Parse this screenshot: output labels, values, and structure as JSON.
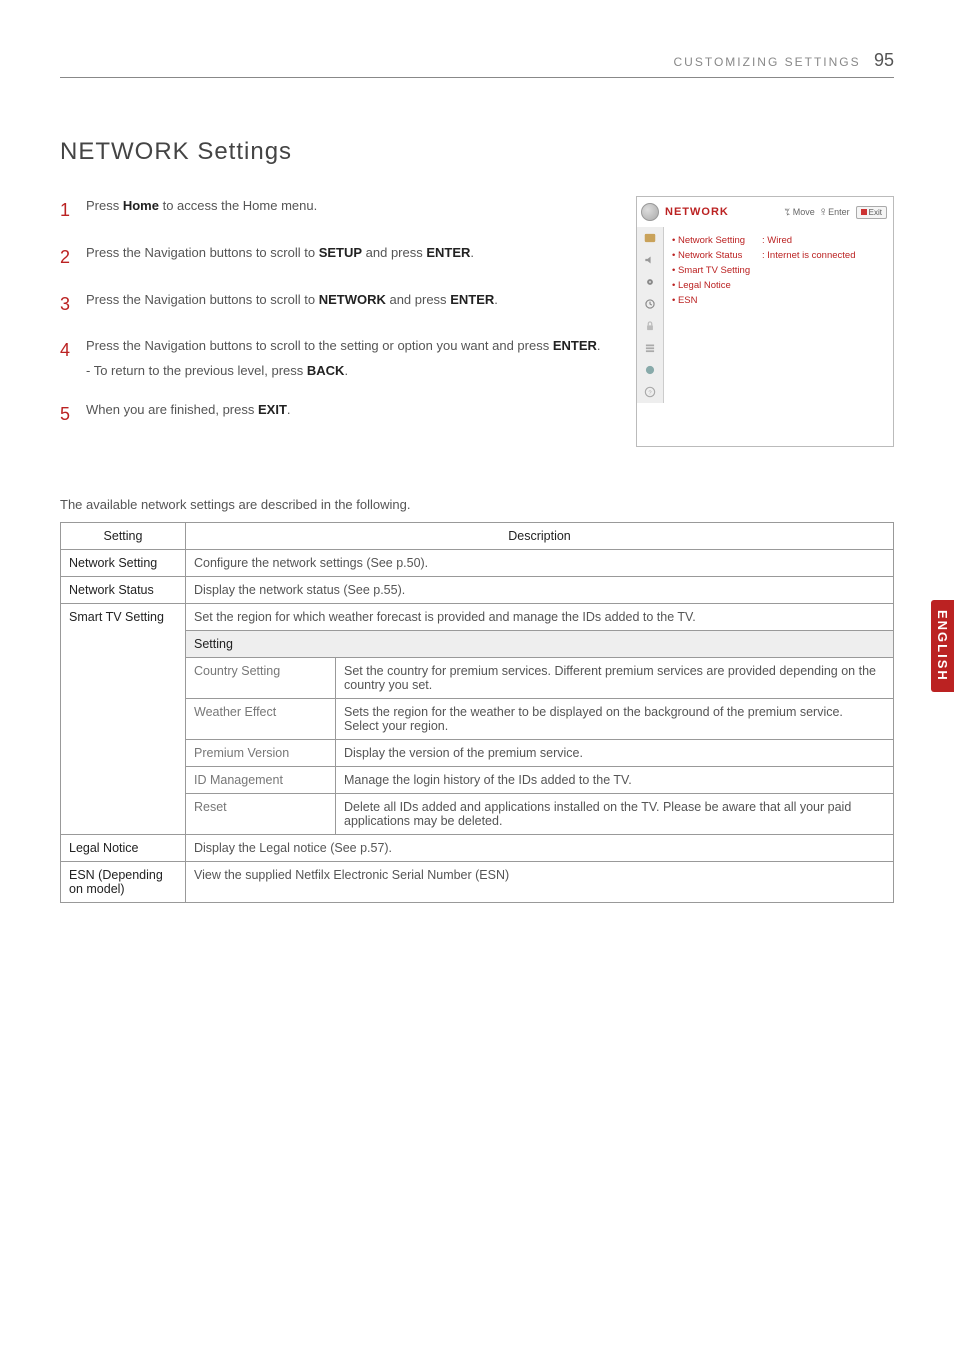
{
  "header": {
    "section_title": "CUSTOMIZING SETTINGS",
    "page_number": "95"
  },
  "title": "NETWORK Settings",
  "steps": [
    {
      "num": "1",
      "pre": "Press ",
      "b1": "Home",
      "post": " to access the Home menu."
    },
    {
      "num": "2",
      "pre": "Press the Navigation buttons to scroll to ",
      "b1": "SETUP",
      "mid": " and press ",
      "b2": "ENTER",
      "post": "."
    },
    {
      "num": "3",
      "pre": "Press the Navigation buttons to scroll to ",
      "b1": "NETWORK",
      "mid": " and press ",
      "b2": "ENTER",
      "post": "."
    },
    {
      "num": "4",
      "pre": "Press the Navigation buttons to scroll to the setting or option you want and press ",
      "b1": "ENTER",
      "post": ".",
      "sub_pre": "- To return to the previous level, press ",
      "sub_b": "BACK",
      "sub_post": "."
    },
    {
      "num": "5",
      "pre": "When you are finished, press ",
      "b1": "EXIT",
      "post": "."
    }
  ],
  "osd": {
    "title": "NETWORK",
    "hint_move": "ꔂ Move",
    "hint_enter": "ꕉ Enter",
    "exit_label": "Exit",
    "items": [
      {
        "label": "Network Setting",
        "value": ": Wired"
      },
      {
        "label": "Network Status",
        "value": ": Internet is connected"
      },
      {
        "label": "Smart TV Setting",
        "value": ""
      },
      {
        "label": "Legal Notice",
        "value": ""
      },
      {
        "label": "ESN",
        "value": ""
      }
    ]
  },
  "intro": "The available network settings are described in the following.",
  "table": {
    "head_setting": "Setting",
    "head_description": "Description",
    "rows": {
      "network_setting": {
        "label": "Network Setting",
        "desc": "Configure the network settings (See p.50)."
      },
      "network_status": {
        "label": "Network Status",
        "desc": "Display the network status (See p.55)."
      },
      "smart_tv": {
        "label": "Smart TV Setting",
        "desc": "Set the region for which weather forecast is provided and manage the IDs added to the TV.",
        "sub_header": "Setting",
        "subs": [
          {
            "label": "Country Setting",
            "desc": "Set the country for premium services. Different premium services are provided depending on the country you set."
          },
          {
            "label": "Weather Effect",
            "desc": "Sets the region for the weather to be displayed on the background of the premium service.\nSelect your region."
          },
          {
            "label": "Premium Version",
            "desc": "Display the version of the premium service."
          },
          {
            "label": "ID Management",
            "desc": "Manage the login history of the IDs added to the TV."
          },
          {
            "label": "Reset",
            "desc": "Delete all IDs added and applications installed on the TV. Please be aware that all your paid applications may be deleted."
          }
        ]
      },
      "legal_notice": {
        "label": "Legal Notice",
        "desc": "Display the Legal notice (See p.57)."
      },
      "esn": {
        "label": "ESN  (Depending on model)",
        "desc": "View the supplied Netfilx Electronic Serial Number (ESN)"
      }
    }
  },
  "side_tab": "ENGLISH"
}
